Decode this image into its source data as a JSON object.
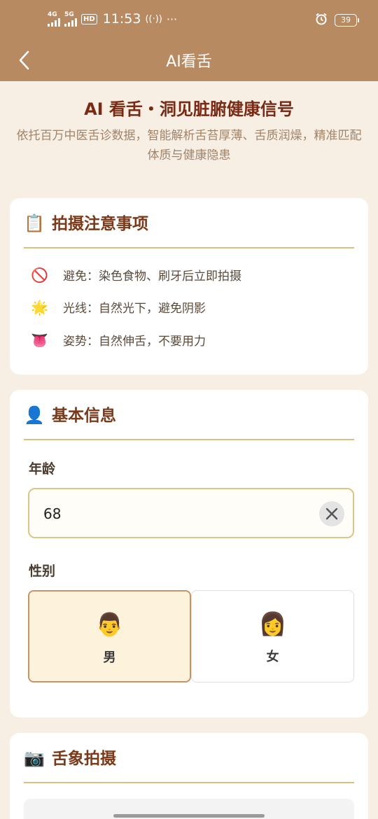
{
  "status_bar": {
    "signal1_label": "4G",
    "signal2_label": "5G",
    "hd_label": "HD",
    "time": "11:53",
    "more": "···",
    "battery": "39"
  },
  "nav": {
    "title": "AI看舌"
  },
  "hero": {
    "title": "AI 看舌・洞见脏腑健康信号",
    "subtitle": "依托百万中医舌诊数据，智能解析舌苔厚薄、舌质润燥，精准匹配体质与健康隐患"
  },
  "notes_card": {
    "icon": "📋",
    "title": "拍摄注意事项",
    "items": [
      {
        "icon": "🚫",
        "text": "避免：染色食物、刷牙后立即拍摄"
      },
      {
        "icon": "🌟",
        "text": "光线：自然光下，避免阴影"
      },
      {
        "icon": "👅",
        "text": "姿势：自然伸舌，不要用力"
      }
    ]
  },
  "info_card": {
    "icon": "👤",
    "title": "基本信息",
    "age_label": "年龄",
    "age_value": "68",
    "gender_label": "性别",
    "gender_options": [
      {
        "icon": "👨",
        "label": "男",
        "selected": true
      },
      {
        "icon": "👩",
        "label": "女",
        "selected": false
      }
    ]
  },
  "photo_card": {
    "icon": "📷",
    "title": "舌象拍摄"
  },
  "colors": {
    "header_bg": "#b88a62",
    "page_bg": "#f7efe4",
    "title_red": "#7a2a14",
    "accent_gold": "#d8c080"
  }
}
